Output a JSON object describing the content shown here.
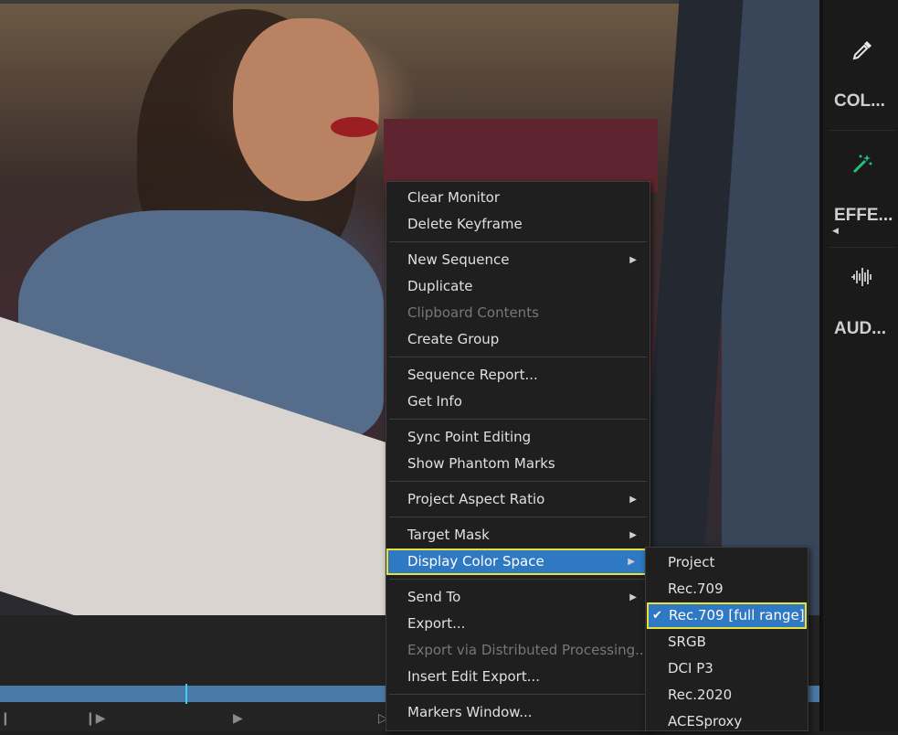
{
  "panel": {
    "items": [
      {
        "label": "COL...",
        "icon": "eyedropper-icon"
      },
      {
        "label": "EFFE...",
        "icon": "magic-wand-icon"
      },
      {
        "label": "AUD...",
        "icon": "audio-waveform-icon"
      }
    ]
  },
  "context_menu": {
    "items": [
      {
        "label": "Clear Monitor"
      },
      {
        "label": "Delete Keyframe"
      },
      {
        "label": "New Sequence",
        "submenu": true
      },
      {
        "label": "Duplicate"
      },
      {
        "label": "Clipboard Contents",
        "disabled": true
      },
      {
        "label": "Create Group"
      },
      {
        "label": "Sequence Report..."
      },
      {
        "label": "Get Info"
      },
      {
        "label": "Sync Point Editing"
      },
      {
        "label": "Show Phantom Marks"
      },
      {
        "label": "Project Aspect Ratio",
        "submenu": true
      },
      {
        "label": "Target Mask",
        "submenu": true
      },
      {
        "label": "Display Color Space",
        "submenu": true,
        "highlighted": true
      },
      {
        "label": "Send To",
        "submenu": true
      },
      {
        "label": "Export..."
      },
      {
        "label": "Export via Distributed Processing...",
        "disabled": true
      },
      {
        "label": "Insert Edit Export..."
      },
      {
        "label": "Markers Window..."
      }
    ]
  },
  "color_space_submenu": {
    "items": [
      {
        "label": "Project"
      },
      {
        "label": "Rec.709"
      },
      {
        "label": "Rec.709 [full range]",
        "checked": true,
        "highlighted": true
      },
      {
        "label": "SRGB"
      },
      {
        "label": "DCI P3"
      },
      {
        "label": "Rec.2020"
      },
      {
        "label": "ACESproxy"
      }
    ]
  },
  "colors": {
    "highlight": "#2f78c4",
    "focus_outline": "#e8e03a",
    "menu_bg": "#1f1f1f",
    "effects_icon": "#22c07a"
  }
}
